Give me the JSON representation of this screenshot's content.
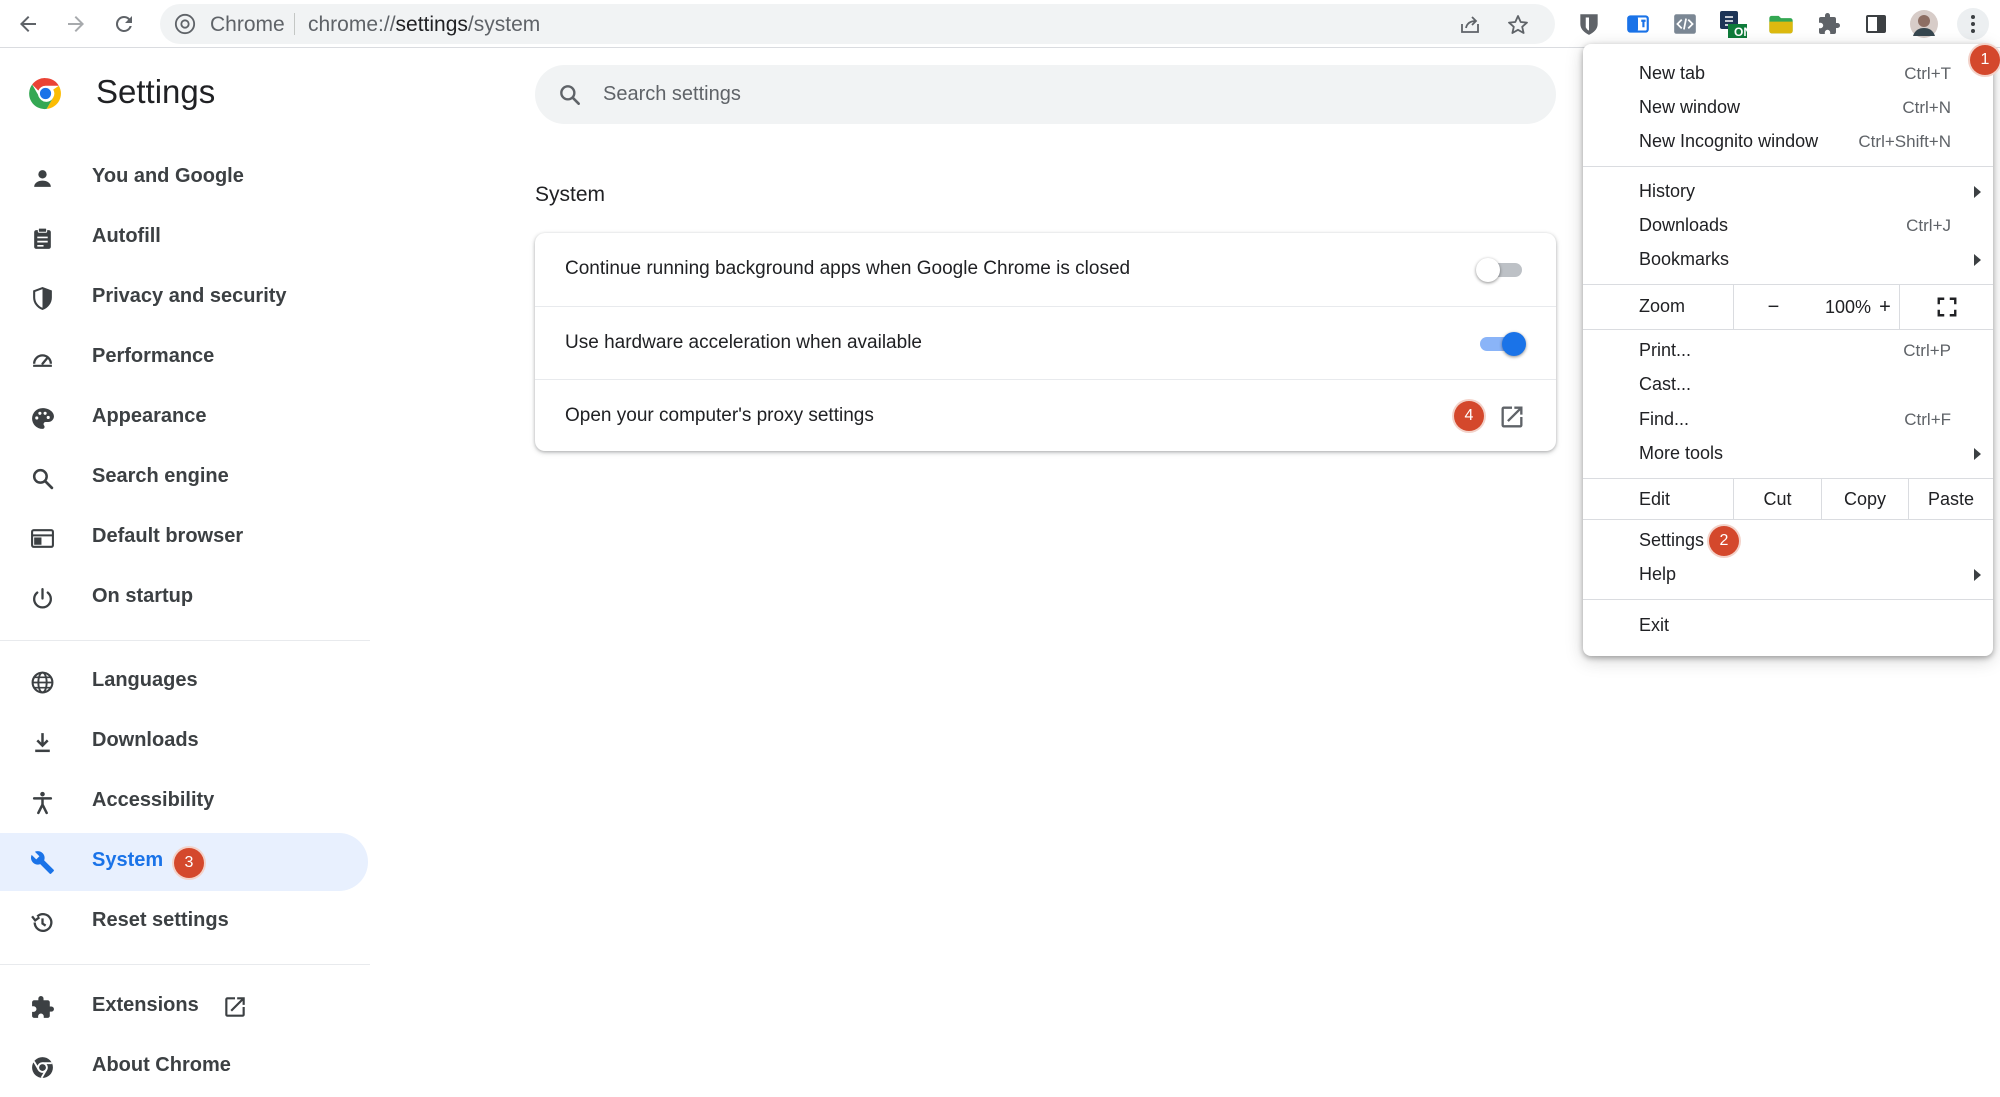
{
  "toolbar": {
    "back_icon": "arrow-left",
    "forward_icon": "arrow-right",
    "reload_icon": "reload",
    "chip_label": "Chrome",
    "url_scheme": "chrome://",
    "url_host": "settings",
    "url_path": "/system",
    "ext_on_badge": "ON"
  },
  "nav": {
    "brand_title": "Settings",
    "items": [
      {
        "label": "You and Google",
        "icon": "person-icon"
      },
      {
        "label": "Autofill",
        "icon": "clipboard-icon"
      },
      {
        "label": "Privacy and security",
        "icon": "shield-icon"
      },
      {
        "label": "Performance",
        "icon": "speedometer-icon"
      },
      {
        "label": "Appearance",
        "icon": "palette-icon"
      },
      {
        "label": "Search engine",
        "icon": "search-icon"
      },
      {
        "label": "Default browser",
        "icon": "browser-window-icon"
      },
      {
        "label": "On startup",
        "icon": "power-icon"
      },
      {
        "label": "Languages",
        "icon": "globe-icon"
      },
      {
        "label": "Downloads",
        "icon": "download-icon"
      },
      {
        "label": "Accessibility",
        "icon": "accessibility-icon"
      },
      {
        "label": "System",
        "icon": "wrench-icon",
        "active": true
      },
      {
        "label": "Reset settings",
        "icon": "history-icon"
      },
      {
        "label": "Extensions",
        "icon": "puzzle-icon"
      },
      {
        "label": "About Chrome",
        "icon": "chrome-icon"
      }
    ]
  },
  "main": {
    "search_placeholder": "Search settings",
    "section_title": "System",
    "rows": [
      {
        "label": "Continue running background apps when Google Chrome is closed",
        "toggle": false
      },
      {
        "label": "Use hardware acceleration when available",
        "toggle": true
      },
      {
        "label": "Open your computer's proxy settings"
      }
    ]
  },
  "badges": {
    "menu": "1",
    "settings": "2",
    "system": "3",
    "proxy": "4"
  },
  "menu": {
    "new_tab": {
      "label": "New tab",
      "shortcut": "Ctrl+T"
    },
    "new_window": {
      "label": "New window",
      "shortcut": "Ctrl+N"
    },
    "new_incognito": {
      "label": "New Incognito window",
      "shortcut": "Ctrl+Shift+N"
    },
    "history": {
      "label": "History"
    },
    "downloads": {
      "label": "Downloads",
      "shortcut": "Ctrl+J"
    },
    "bookmarks": {
      "label": "Bookmarks"
    },
    "zoom": {
      "label": "Zoom",
      "minus": "−",
      "level": "100%",
      "plus": "+"
    },
    "print": {
      "label": "Print...",
      "shortcut": "Ctrl+P"
    },
    "cast": {
      "label": "Cast..."
    },
    "find": {
      "label": "Find...",
      "shortcut": "Ctrl+F"
    },
    "more_tools": {
      "label": "More tools"
    },
    "edit": {
      "label": "Edit",
      "cut": "Cut",
      "copy": "Copy",
      "paste": "Paste"
    },
    "settings": {
      "label": "Settings"
    },
    "help": {
      "label": "Help"
    },
    "exit": {
      "label": "Exit"
    }
  },
  "colors": {
    "accent": "#1a73e8",
    "badge": "#d4482c",
    "active_bg": "#e8f0fe"
  }
}
